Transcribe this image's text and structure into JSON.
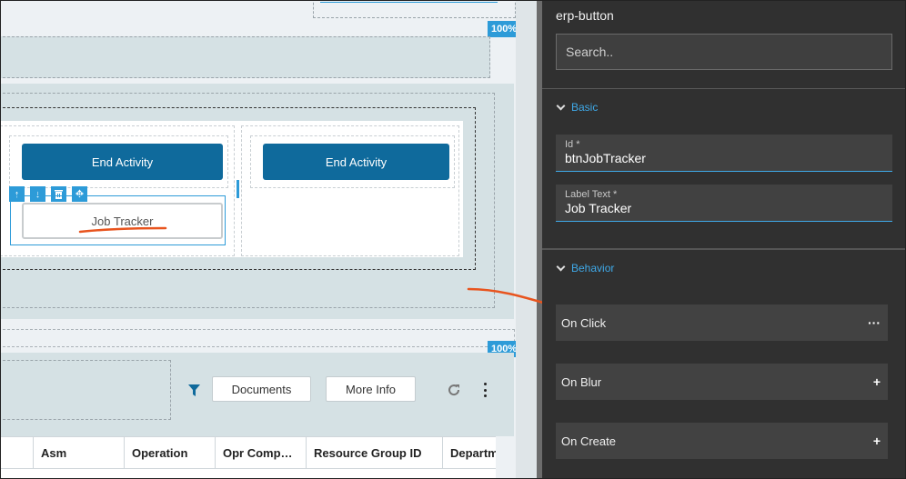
{
  "canvas": {
    "zoom_top": "100%",
    "zoom_bottom": "100%",
    "left_column": {
      "end_activity_label": "End Activity",
      "job_tracker_label": "Job Tracker"
    },
    "right_column": {
      "end_activity_label": "End Activity"
    },
    "toolbar": {
      "documents_label": "Documents",
      "more_info_label": "More Info"
    },
    "grid": {
      "columns": [
        "Asm",
        "Operation",
        "Opr Comp…",
        "Resource Group ID",
        "Departm"
      ]
    }
  },
  "panel": {
    "component_name": "erp-button",
    "search_placeholder": "Search..",
    "sections": {
      "basic": "Basic",
      "behavior": "Behavior"
    },
    "fields": {
      "id": {
        "label": "Id *",
        "value": "btnJobTracker"
      },
      "label_text": {
        "label": "Label Text *",
        "value": "Job Tracker"
      }
    },
    "events": [
      {
        "label": "On Click",
        "action": "···"
      },
      {
        "label": "On Blur",
        "action": "+"
      },
      {
        "label": "On Create",
        "action": "+"
      }
    ]
  },
  "colors": {
    "accent": "#2d9bd8",
    "primary_button": "#0f6a9c",
    "panel_bg": "#303030",
    "annotation": "#e8541e"
  }
}
